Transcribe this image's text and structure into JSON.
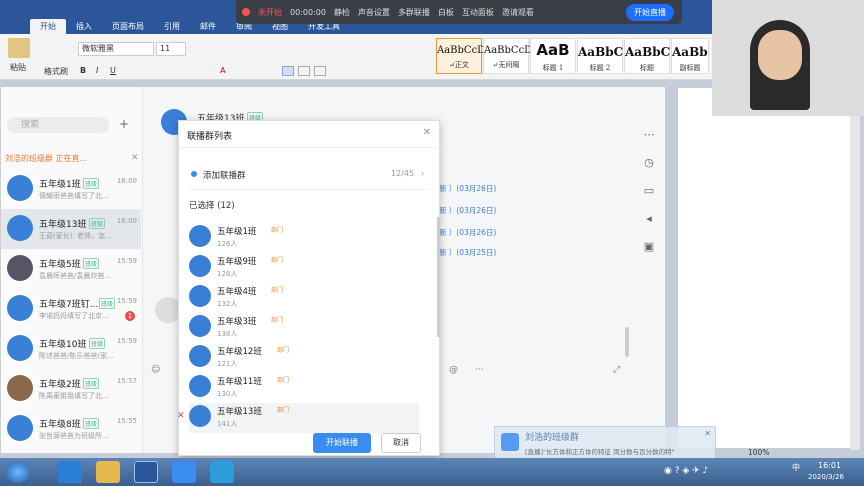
{
  "word": {
    "tabs": [
      "开始",
      "插入",
      "页面布局",
      "引用",
      "邮件",
      "审阅",
      "视图",
      "开发工具"
    ],
    "font_name": "微软雅黑",
    "font_size": "11",
    "paste_label": "粘贴",
    "format_painter": "格式刷",
    "styles": [
      {
        "sample": "AaBbCcD",
        "name": "↵正文"
      },
      {
        "sample": "AaBbCcD",
        "name": "↵无间隔"
      },
      {
        "sample": "AaB",
        "name": "标题 1"
      },
      {
        "sample": "AaBbC",
        "name": "标题 2"
      },
      {
        "sample": "AaBbC",
        "name": "标题"
      },
      {
        "sample": "AaBbC",
        "name": "副标题"
      }
    ]
  },
  "recorder": {
    "status": "未开始",
    "time": "00:00:00",
    "items": [
      "静检",
      "声音设置",
      "多群联播",
      "白板",
      "互动面板",
      "邀请观看"
    ],
    "start_button": "开始直播"
  },
  "dingtalk": {
    "search_placeholder": "搜索",
    "banner": "刘浩的班级群 正在直...",
    "header_title": "五年级13班",
    "header_tag": "班级",
    "chats": [
      {
        "name": "五年级1班",
        "tag": "班级",
        "time": "16:00",
        "msg": "佩耀雨爸爸填写了北..."
      },
      {
        "name": "五年级13班",
        "tag": "班级",
        "time": "16:00",
        "msg": "王茹(家长): 老师，怎..."
      },
      {
        "name": "五年级5班",
        "tag": "班级",
        "time": "15:59",
        "msg": "袁晨晖爸爸/袁晨欣爸..."
      },
      {
        "name": "五年级7班钉...",
        "tag": "班级",
        "time": "15:59",
        "msg": "李诺妈妈填写了北京..."
      },
      {
        "name": "五年级10班",
        "tag": "班级",
        "time": "15:59",
        "msg": "陈述爸爸/陈乐爸爸(家..."
      },
      {
        "name": "五年级2班",
        "tag": "班级",
        "time": "15:57",
        "msg": "陈禹豪姐姐填写了北..."
      },
      {
        "name": "五年级8班",
        "tag": "班级",
        "time": "15:55",
        "msg": "张哲源爸爸为班级所..."
      }
    ],
    "chat_dates": [
      "新 ）(03月26日)",
      "新 ）(03月26日)",
      "新 ）(03月26日)",
      "新 ）(03月25日)"
    ],
    "unread": "1"
  },
  "modal": {
    "title": "联播群列表",
    "add_label": "添加联播群",
    "add_count": "12/45",
    "selected_label": "已选择 (12)",
    "groups": [
      {
        "name": "五年级1班",
        "tag": "部门",
        "count": "126人"
      },
      {
        "name": "五年级9班",
        "tag": "部门",
        "count": "128人"
      },
      {
        "name": "五年级4班",
        "tag": "部门",
        "count": "132人"
      },
      {
        "name": "五年级3班",
        "tag": "部门",
        "count": "138人"
      },
      {
        "name": "五年级12班",
        "tag": "部门",
        "count": "121人"
      },
      {
        "name": "五年级11班",
        "tag": "部门",
        "count": "130人"
      },
      {
        "name": "五年级13班",
        "tag": "部门",
        "count": "141人"
      }
    ],
    "start_button": "开始联播",
    "cancel_button": "取消"
  },
  "notification": {
    "title": "刘浩的班级群",
    "text": "[直播]\"长方体和正方体的特征  両分数与百分数的特\""
  },
  "statusbar": {
    "zoom": "100%"
  },
  "taskbar": {
    "time": "16:01",
    "date": "2020/3/26",
    "ime": "中"
  }
}
